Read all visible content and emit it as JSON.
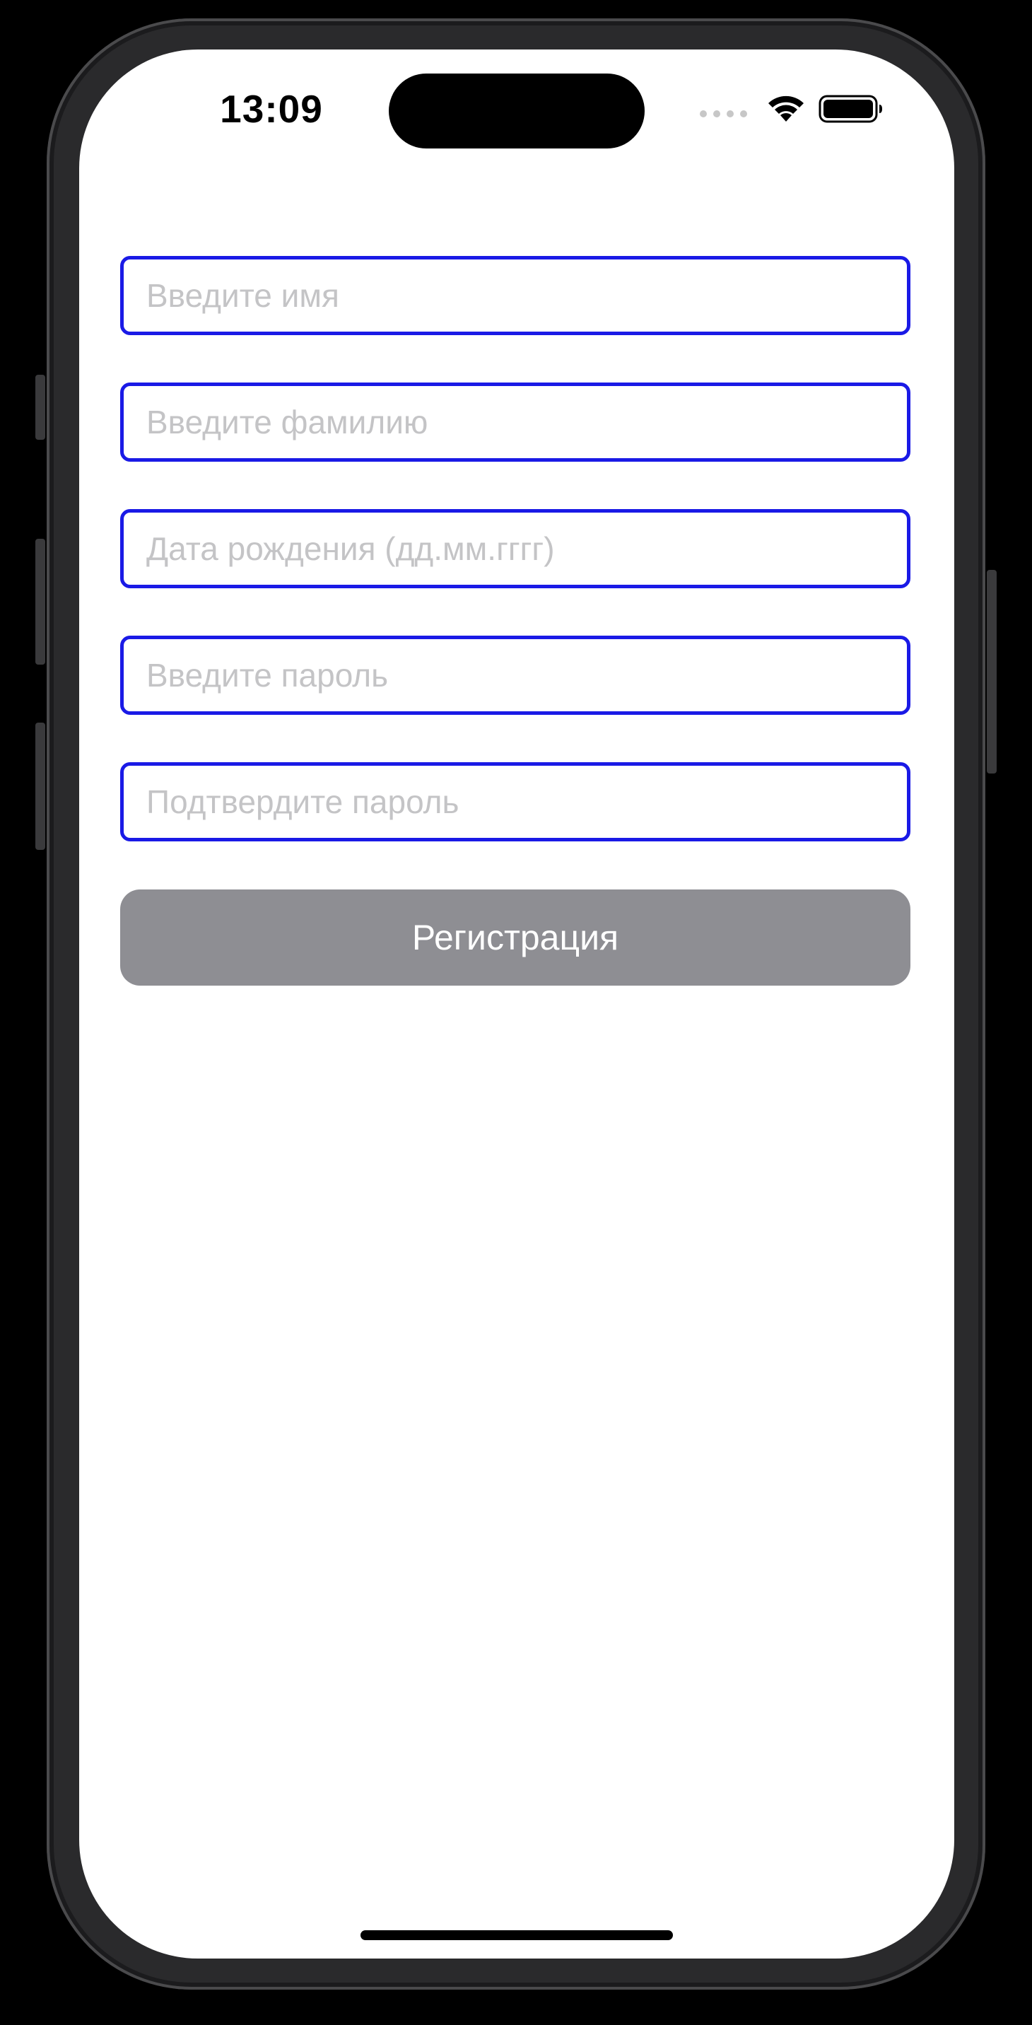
{
  "status_bar": {
    "time": "13:09",
    "icons": [
      "signal-dots-icon",
      "wifi-icon",
      "battery-icon"
    ]
  },
  "form": {
    "first_name_placeholder": "Введите имя",
    "last_name_placeholder": "Введите фамилию",
    "birthdate_placeholder": "Дата рождения (дд.мм.гггг)",
    "password_placeholder": "Введите пароль",
    "confirm_password_placeholder": "Подтвердите пароль",
    "first_name_value": "",
    "last_name_value": "",
    "birthdate_value": "",
    "password_value": "",
    "confirm_password_value": "",
    "field_border_color": "#1a1ae6",
    "placeholder_color": "#c4c4c6"
  },
  "register_button": {
    "label": "Регистрация",
    "background": "#8e8e93",
    "text_color": "#ffffff"
  }
}
